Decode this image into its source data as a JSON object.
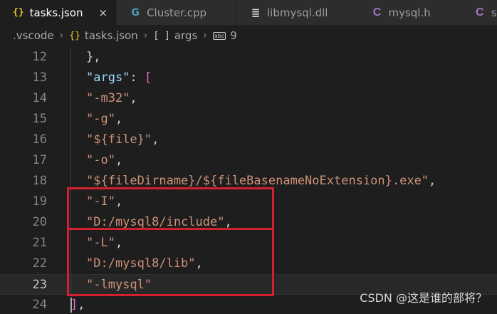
{
  "tabs": [
    {
      "label": "tasks.json",
      "icon": "json-braces-icon",
      "glyph": "{}",
      "active": true
    },
    {
      "label": "Cluster.cpp",
      "icon": "cpp-file-icon",
      "glyph": "G"
    },
    {
      "label": "libmysql.dll",
      "icon": "dll-file-icon",
      "glyph": "≣"
    },
    {
      "label": "mysql.h",
      "icon": "c-header-icon",
      "glyph": "C"
    },
    {
      "label": "stdio.h",
      "icon": "c-header-icon",
      "glyph": "C"
    }
  ],
  "tab_close_glyph": "×",
  "breadcrumb": {
    "folder": ".vscode",
    "file": "tasks.json",
    "file_glyph": "{}",
    "array_glyph": "[ ]",
    "array": "args",
    "item_glyph": "abc",
    "item": "9",
    "sep": "›"
  },
  "editor": {
    "current_line": 23,
    "lines": [
      {
        "num": "12",
        "tokens": [
          [
            "},",
            "t-pun"
          ]
        ],
        "braceFirst": true
      },
      {
        "num": "13",
        "tokens": [
          [
            "\"args\"",
            "t-key"
          ],
          [
            ": ",
            "t-pun"
          ],
          [
            "[",
            "t-br1"
          ]
        ]
      },
      {
        "num": "14",
        "tokens": [
          [
            "\"-m32\"",
            "t-str"
          ],
          [
            ",",
            "t-pun"
          ]
        ]
      },
      {
        "num": "15",
        "tokens": [
          [
            "\"-g\"",
            "t-str"
          ],
          [
            ",",
            "t-pun"
          ]
        ]
      },
      {
        "num": "16",
        "tokens": [
          [
            "\"${file}\"",
            "t-str"
          ],
          [
            ",",
            "t-pun"
          ]
        ]
      },
      {
        "num": "17",
        "tokens": [
          [
            "\"-o\"",
            "t-str"
          ],
          [
            ",",
            "t-pun"
          ]
        ]
      },
      {
        "num": "18",
        "tokens": [
          [
            "\"${fileDirname}/${fileBasenameNoExtension}.exe\"",
            "t-str"
          ],
          [
            ",",
            "t-pun"
          ]
        ]
      },
      {
        "num": "19",
        "tokens": [
          [
            "\"-I\"",
            "t-str"
          ],
          [
            ",",
            "t-pun"
          ]
        ]
      },
      {
        "num": "20",
        "tokens": [
          [
            "\"D:/mysql8/include\"",
            "t-str"
          ],
          [
            ",",
            "t-pun"
          ]
        ]
      },
      {
        "num": "21",
        "tokens": [
          [
            "\"-L\"",
            "t-str"
          ],
          [
            ",",
            "t-pun"
          ]
        ]
      },
      {
        "num": "22",
        "tokens": [
          [
            "\"D:/mysql8/lib\"",
            "t-str"
          ],
          [
            ",",
            "t-pun"
          ]
        ]
      },
      {
        "num": "23",
        "tokens": [
          [
            "\"-lmysql\"",
            "t-str"
          ]
        ]
      },
      {
        "num": "24",
        "tokens": [
          [
            "]",
            "t-br1"
          ],
          [
            ",",
            "t-pun"
          ]
        ],
        "outdent": true
      }
    ]
  },
  "highlight_color": "#d2202d",
  "watermark": "CSDN @这是谁的部将？"
}
